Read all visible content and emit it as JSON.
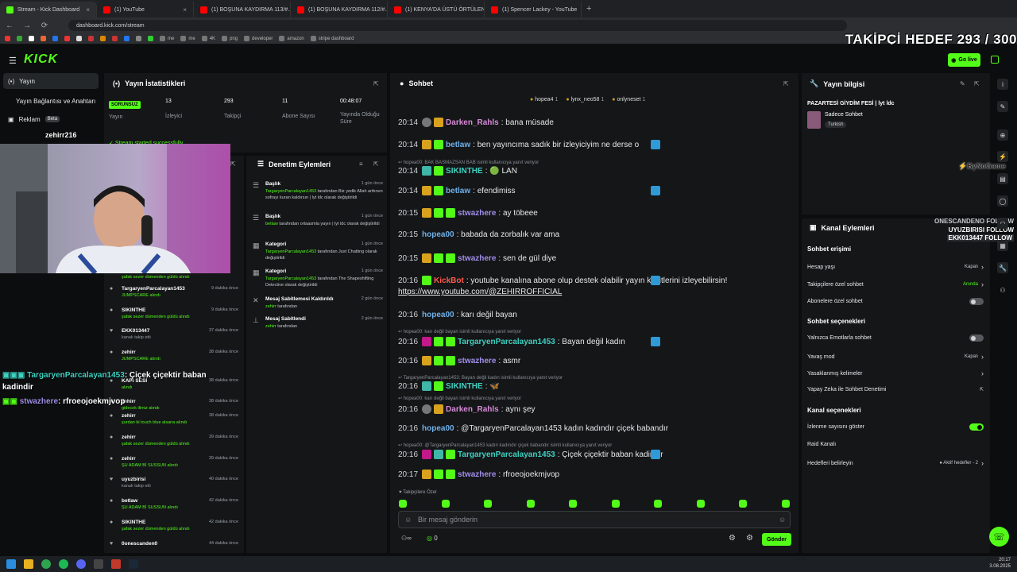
{
  "browser": {
    "tabs": [
      {
        "label": "Stream - Kick Dashboard",
        "color": "#53fc18"
      },
      {
        "label": "(1) YouTube",
        "color": "#ff0000"
      },
      {
        "label": "(1) BOŞUNA KAYDIRMA 113/#...",
        "color": "#ff0000"
      },
      {
        "label": "(1) BOŞUNA KAYDIRMA 112/#...",
        "color": "#ff0000"
      },
      {
        "label": "(1) KENYA'DA ÜSTÜ ÖRTÜLEN ...",
        "color": "#ff0000"
      },
      {
        "label": "(1) Spencer Lackey - YouTube",
        "color": "#ff0000"
      }
    ],
    "url": "dashboard.kick.com/stream",
    "bookmarks": [
      "me",
      "me",
      "4K",
      "png",
      "developer",
      "amazon",
      "stripe dashboard"
    ]
  },
  "overlay": {
    "goal": "TAKİPÇİ HEDEF 293 / 300",
    "sponsor": "ByNoGame",
    "follows": [
      {
        "text": "ONESCANDENO FOLLOW",
        "color": "#c9cbce"
      },
      {
        "text": "UYUZBIRISI FOLLOW",
        "color": "#ffffff"
      },
      {
        "text": "EKK013447 FOLLOW",
        "color": "#ffffff"
      }
    ],
    "chat": [
      {
        "user": "TargaryenParcalayan1453",
        "text": ": Çiçek çiçektir baban",
        "cont": "kadindir",
        "color": "#3fd0c0"
      },
      {
        "user": "stwazhere",
        "text": ": rfroeojoekmjvop",
        "color": "#a08ee8"
      }
    ],
    "webcam_name": "zehirr216"
  },
  "kick": {
    "logo": "KICK",
    "go_live": "Go live"
  },
  "sidebar": {
    "items": [
      {
        "label": "Yayın"
      },
      {
        "label": "Yayın Bağlantısı ve Anahtarı"
      },
      {
        "label": "Reklam",
        "badge": "Beta"
      }
    ]
  },
  "stats": {
    "title": "Yayın İstatistikleri",
    "status": "SORUNSUZ",
    "status_label": "Yayın",
    "items": [
      {
        "value": "13",
        "label": "İzleyici"
      },
      {
        "value": "293",
        "label": "Takipçi"
      },
      {
        "value": "11",
        "label": "Abone Sayısı"
      },
      {
        "value": "00:48:07",
        "label": "Yayında Olduğu Süre"
      }
    ],
    "notice": "Stream started successfully"
  },
  "activity": [
    {
      "name": "şafak sezer dümenden güldü",
      "sub": "alındı",
      "time": ""
    },
    {
      "name": "TargaryenParcalayan1453",
      "sub": "JUMPSCARE alındı",
      "time": "9 dakika önce",
      "icon": "●"
    },
    {
      "name": "SIKINTHE",
      "sub": "şafak sezer dümenden güldü alındı",
      "time": "9 dakika önce",
      "icon": "●"
    },
    {
      "name": "EKK013447",
      "sub": "kanalı takip etti",
      "time": "37 dakika önce",
      "icon": "♥",
      "gray": true
    },
    {
      "name": "zehirr",
      "sub": "JUMPSCARE alındı",
      "time": "38 dakika önce",
      "icon": "●"
    },
    {
      "name": "KAPI SESİ",
      "sub": "alındı",
      "time": "38 dakika önce",
      "icon": "●"
    },
    {
      "name": "zehirr",
      "sub": "gidecek ilimiz alındı",
      "time": "38 dakika önce",
      "icon": "●"
    },
    {
      "name": "zehirr",
      "sub": "şurdan bi touch blue alsana alındı",
      "time": "38 dakika önce",
      "icon": "●"
    },
    {
      "name": "zehirr",
      "sub": "şafak sezer dümenden güldü alındı",
      "time": "39 dakika önce",
      "icon": "●"
    },
    {
      "name": "zehirr",
      "sub": "ŞU ADAM Bİ SUSSUN alındı",
      "time": "39 dakika önce",
      "icon": "●"
    },
    {
      "name": "uyuzbirisi",
      "sub": "kanalı takip etti",
      "time": "40 dakika önce",
      "icon": "♥",
      "gray": true
    },
    {
      "name": "betlaw",
      "sub": "ŞU ADAM Bİ SUSSUN alındı",
      "time": "42 dakika önce",
      "icon": "●"
    },
    {
      "name": "SIKINTHE",
      "sub": "şafak sezer dümenden güldü alındı",
      "time": "42 dakika önce",
      "icon": "●"
    },
    {
      "name": "0onescanden0",
      "sub": "",
      "time": "44 dakika önce",
      "icon": "♥"
    }
  ],
  "moderation": {
    "title": "Denetim Eylemleri",
    "items": [
      {
        "head": "Başlık",
        "time": "1 gün önce",
        "desc": "TargaryenParcalayan1453 tarafından Biz yedik Allah arttırsın sofrayı kuran kaldırsın | lyt ldc olarak değiştirildi",
        "icon": "☰"
      },
      {
        "head": "Başlık",
        "time": "1 gün önce",
        "desc": "betlaw tarafından ortaasmla yayın | lyt ldc olarak değiştirildi",
        "icon": "☰"
      },
      {
        "head": "Kategori",
        "time": "1 gün önce",
        "desc": "TargaryenParcalayan1453 tarafından Just Chatting olarak değiştirildi",
        "icon": "▦"
      },
      {
        "head": "Kategori",
        "time": "1 gün önce",
        "desc": "TargaryenParcalayan1453 tarafından The Shapeshifting Detective olarak değiştirildi",
        "icon": "▦"
      },
      {
        "head": "Mesaj Sabitlemesi Kaldırıldı",
        "time": "2 gün önce",
        "desc": "zehirr tarafından",
        "icon": "✕"
      },
      {
        "head": "Mesaj Sabitlendi",
        "time": "2 gün önce",
        "desc": "zehirr tarafından",
        "icon": "⊥"
      }
    ]
  },
  "chat": {
    "title": "Sohbet",
    "top_users": [
      {
        "name": "hopea4",
        "count": "1"
      },
      {
        "name": "lynx_neo58",
        "count": "1"
      },
      {
        "name": "onlyneset",
        "count": "1"
      }
    ],
    "messages": [
      {
        "ts": "20:14",
        "user": "Darken_Rahls",
        "color": "#d88ad8",
        "badges": [
          "gray",
          "crown"
        ],
        "text": ": bana müsade"
      },
      {
        "ts": "20:14",
        "user": "betlaw",
        "color": "#6fb0e8",
        "badges": [
          "crown",
          "sub",
          "mod"
        ],
        "text": ": ben yayıncıma sadık bir izleyiciyim ne derse o"
      },
      {
        "reply": "hopea00: BAK BASMAZSAN BAB isimli kullanıcıya yanıt veriyor"
      },
      {
        "ts": "20:14",
        "user": "SIKINTHE",
        "color": "#3fd0c0",
        "badges": [
          "gift",
          "sub"
        ],
        "text": ": 🟢 LAN"
      },
      {
        "ts": "20:14",
        "user": "betlaw",
        "color": "#6fb0e8",
        "badges": [
          "crown",
          "sub",
          "mod"
        ],
        "text": ": efendimiss"
      },
      {
        "ts": "20:15",
        "user": "stwazhere",
        "color": "#a08ee8",
        "badges": [
          "crown",
          "sub",
          "sub"
        ],
        "text": ": ay töbeee"
      },
      {
        "ts": "20:15",
        "user": "hopea00",
        "color": "#6fb0e8",
        "badges": [],
        "text": ": babada da zorbalık var ama"
      },
      {
        "ts": "20:15",
        "user": "stwazhere",
        "color": "#a08ee8",
        "badges": [
          "crown",
          "sub",
          "sub"
        ],
        "text": ": sen de gül diye"
      },
      {
        "ts": "20:16",
        "user": "KickBot",
        "color": "#ff5a4a",
        "badges": [
          "mod",
          "sub"
        ],
        "text": ": youtube kanalına abone olup destek olabilir yayın kesitlerini izleyebilirsin!",
        "link": "https://www.youtube.com/@ZEHIRROFFICIAL"
      },
      {
        "ts": "20:16",
        "user": "hopea00",
        "color": "#6fb0e8",
        "badges": [],
        "text": ": karı değil bayan"
      },
      {
        "reply": "hopea00: karı değil bayan isimli kullanıcıya yanıt veriyor"
      },
      {
        "ts": "20:16",
        "user": "TargaryenParcalayan1453",
        "color": "#3fd0c0",
        "badges": [
          "vip",
          "sub",
          "sub",
          "mod"
        ],
        "text": ": Bayan değil kadın"
      },
      {
        "ts": "20:16",
        "user": "stwazhere",
        "color": "#a08ee8",
        "badges": [
          "crown",
          "sub",
          "sub"
        ],
        "text": ": asmr"
      },
      {
        "reply": "TargaryenParcalayan1453: Bayan değil kadın isimli kullanıcıya yanıt veriyor"
      },
      {
        "ts": "20:16",
        "user": "SIKINTHE",
        "color": "#3fd0c0",
        "badges": [
          "gift",
          "sub"
        ],
        "text": ": 🦋"
      },
      {
        "reply": "hopea00: karı değil bayan isimli kullanıcıya yanıt veriyor"
      },
      {
        "ts": "20:16",
        "user": "Darken_Rahls",
        "color": "#d88ad8",
        "badges": [
          "gray",
          "crown"
        ],
        "text": ": aynı şey"
      },
      {
        "ts": "20:16",
        "user": "hopea00",
        "color": "#6fb0e8",
        "badges": [],
        "text": ": @TargaryenParcalayan1453 kadın kadındır çiçek babandır"
      },
      {
        "reply": "hopea00: @TargaryenParcalayan1453 kadın kadındır çiçek babandır isimli kullanıcıya yanıt veriyor"
      },
      {
        "ts": "20:16",
        "user": "TargaryenParcalayan1453",
        "color": "#3fd0c0",
        "badges": [
          "vip",
          "gift",
          "sub",
          "mod"
        ],
        "text": ": Çiçek çiçektir baban kadindir"
      },
      {
        "ts": "20:17",
        "user": "stwazhere",
        "color": "#a08ee8",
        "badges": [
          "crown",
          "sub",
          "sub"
        ],
        "text": ": rfroeojoekmjvop"
      }
    ],
    "followers_only": "Takipçilere Özel",
    "placeholder": "Bir mesaj gönderin",
    "send": "Gönder",
    "counter": "0"
  },
  "stream_info": {
    "title": "Yayın bilgisi",
    "stream_title": "PAZARTESİ GİYDİM FESİ | lyt ldc",
    "category": "Sadece Sohbet",
    "tag": "Turkish"
  },
  "channel": {
    "title": "Kanal Eylemleri",
    "access_title": "Sohbet erişimi",
    "access": [
      {
        "label": "Hesap yaşı",
        "value": "Kapalı",
        "arrow": true
      },
      {
        "label": "Takipçilere özel sohbet",
        "value": "Anında",
        "arrow": true,
        "green": true
      },
      {
        "label": "Abonelere özel sohbet",
        "toggle": false
      }
    ],
    "options_title": "Sohbet seçenekleri",
    "options": [
      {
        "label": "Yalnızca Emotlarla sohbet",
        "toggle": false
      },
      {
        "label": "Yavaş mod",
        "value": "Kapalı",
        "arrow": true
      },
      {
        "label": "Yasaklanmış kelimeler",
        "arrow": true
      },
      {
        "label": "Yapay Zeka ile Sohbet Denetimi",
        "external": true
      }
    ],
    "chan_title": "Kanal seçenekleri",
    "chan": [
      {
        "label": "İzlenme sayısını göster",
        "toggle": true
      },
      {
        "label": "Raid Kanalı"
      },
      {
        "label": "Hedefleri belirleyin",
        "value": "● Aktif hedefler - 2",
        "arrow": true
      }
    ]
  },
  "clock": {
    "time": "20:17",
    "date": "3.08.2025"
  }
}
